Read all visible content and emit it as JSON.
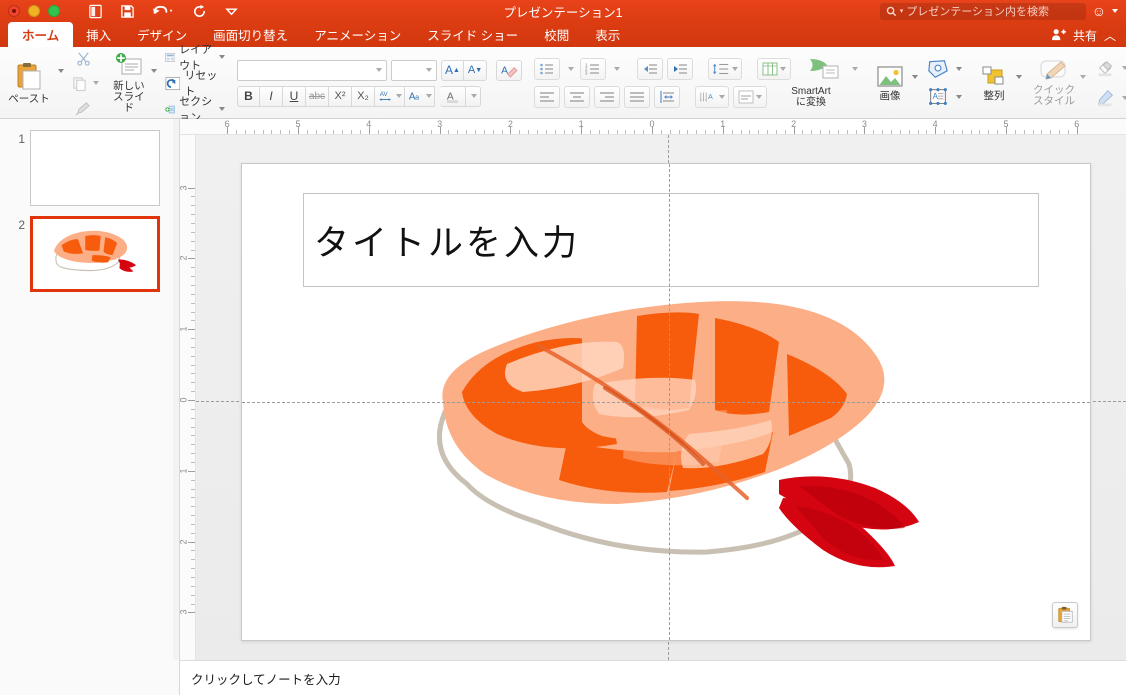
{
  "window": {
    "title": "プレゼンテーション1",
    "traffic_lights": [
      "close",
      "minimize",
      "zoom"
    ],
    "theme_color": "#dd3c12"
  },
  "quick_access": [
    {
      "name": "new-slide-icon",
      "label": "新規"
    },
    {
      "name": "save-icon",
      "label": "保存"
    },
    {
      "name": "undo-icon",
      "label": "元に戻す"
    },
    {
      "name": "redo-icon",
      "label": "やり直し"
    },
    {
      "name": "customize-toolbar-icon",
      "label": "ツールバーのカスタマイズ"
    }
  ],
  "search": {
    "placeholder": "プレゼンテーション内を検索",
    "icon": "search-icon"
  },
  "account": {
    "icon": "smiley-icon"
  },
  "tabs": [
    {
      "label": "ホーム",
      "active": true
    },
    {
      "label": "挿入",
      "active": false
    },
    {
      "label": "デザイン",
      "active": false
    },
    {
      "label": "画面切り替え",
      "active": false
    },
    {
      "label": "アニメーション",
      "active": false
    },
    {
      "label": "スライド ショー",
      "active": false
    },
    {
      "label": "校閲",
      "active": false
    },
    {
      "label": "表示",
      "active": false
    }
  ],
  "tab_right": {
    "share_label": "共有",
    "share_icon": "person-add-icon",
    "collapse_icon": "chevron-up-icon"
  },
  "ribbon": {
    "clipboard": {
      "paste_label": "ペースト",
      "paste_icon": "clipboard-icon",
      "cut_icon": "scissors-icon",
      "copy_icon": "copy-icon",
      "format_painter_icon": "paintbrush-icon"
    },
    "slides": {
      "new_slide_label": "新しい\nスライド",
      "new_slide_line1": "新しい",
      "new_slide_line2": "スライド",
      "new_slide_icon": "new-slide-icon",
      "layout_label": "レイアウト",
      "layout_icon": "layout-icon",
      "reset_label": "リセット",
      "reset_icon": "reset-icon",
      "section_label": "セクション",
      "section_icon": "section-icon"
    },
    "font": {
      "font_name_value": "",
      "font_size_value": "",
      "grow_font_icon": "grow-font-icon",
      "shrink_font_icon": "shrink-font-icon",
      "clear_format_icon": "clear-formatting-icon",
      "bold": "B",
      "italic": "I",
      "underline": "U",
      "strikethrough": "abc",
      "superscript": "X²",
      "subscript": "X₂",
      "character_spacing_icon": "character-spacing-icon",
      "change_case_icon": "change-case-icon",
      "font_color_icon": "font-color-icon"
    },
    "paragraph": {
      "bullets_icon": "bullet-list-icon",
      "numbering_icon": "numbered-list-icon",
      "decrease_indent_icon": "decrease-indent-icon",
      "increase_indent_icon": "increase-indent-icon",
      "line_spacing_icon": "line-spacing-icon",
      "columns_icon": "columns-icon",
      "smartart_label_line1": "SmartArt",
      "smartart_label_line2": "に変換",
      "smartart_icon": "smartart-icon",
      "align_left_icon": "align-left-icon",
      "align_center_icon": "align-center-icon",
      "align_right_icon": "align-right-icon",
      "justify_icon": "justify-icon",
      "distribute_icon": "distribute-text-icon",
      "text_direction_icon": "text-direction-icon",
      "align_text_icon": "align-text-icon"
    },
    "insert": {
      "picture_label": "画像",
      "picture_icon": "picture-icon",
      "shapes_icon": "shapes-icon",
      "textbox_icon": "text-box-icon"
    },
    "drawing": {
      "arrange_label": "整列",
      "arrange_icon": "arrange-icon",
      "quick_styles_line1": "クイック",
      "quick_styles_line2": "スタイル",
      "quick_styles_icon": "quick-styles-icon",
      "shape_fill_icon": "shape-fill-icon",
      "shape_outline_icon": "shape-outline-icon"
    }
  },
  "rulers": {
    "horizontal_ticks": [
      "6",
      "5",
      "4",
      "3",
      "2",
      "1",
      "0",
      "1",
      "2",
      "3",
      "4",
      "5",
      "6"
    ],
    "vertical_ticks": [
      "3",
      "2",
      "1",
      "0",
      "1",
      "2",
      "3"
    ],
    "unit": "inch"
  },
  "slide_panel": {
    "slides": [
      {
        "number": "1",
        "selected": false,
        "has_image": false
      },
      {
        "number": "2",
        "selected": true,
        "has_image": true
      }
    ]
  },
  "slide": {
    "title_placeholder": "タイトルを入力",
    "image": {
      "name": "shrimp-nigiri-sushi-illustration",
      "colors": {
        "shrimp_light": "#fcaf87",
        "shrimp_stripe": "#f75c0c",
        "shrimp_highlight": "#ffd5be",
        "tail_red": "#d40511",
        "tail_dark": "#b00009",
        "rice_white": "#ffffff",
        "rice_outline": "#c8c0b2"
      }
    },
    "paste_options_icon": "paste-options-clipboard-icon"
  },
  "notes": {
    "placeholder": "クリックしてノートを入力"
  }
}
